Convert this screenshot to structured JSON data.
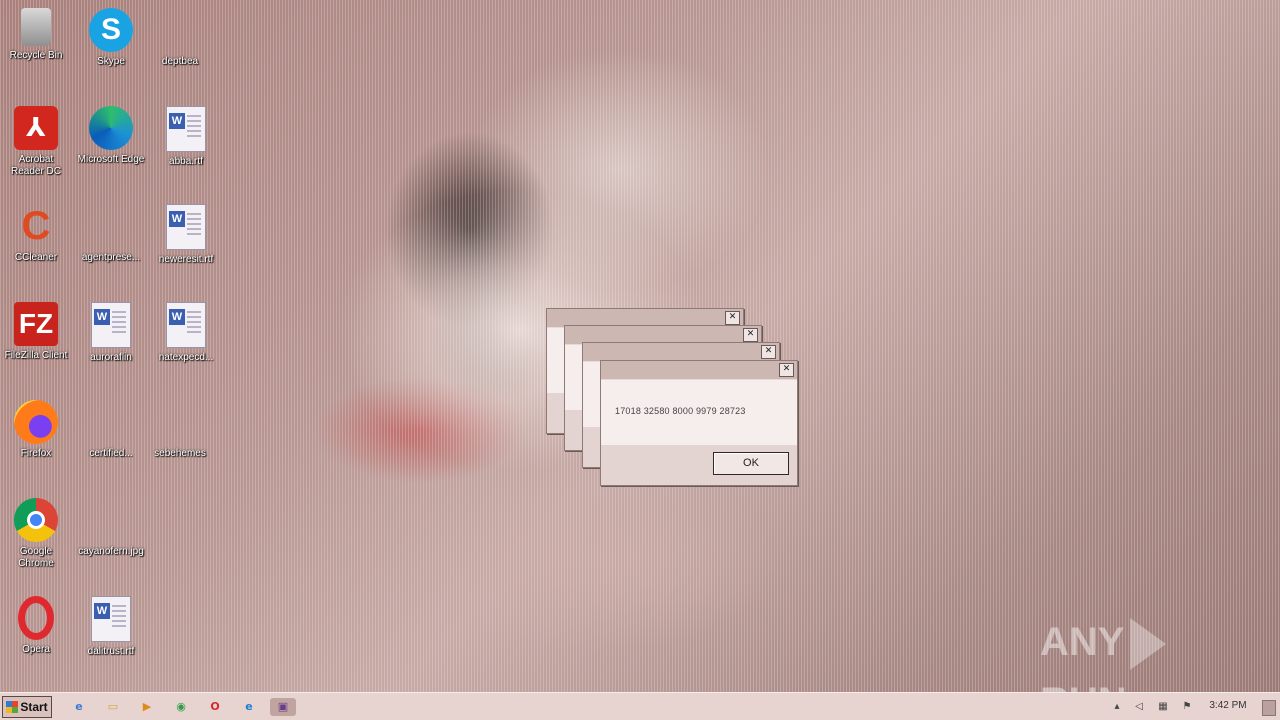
{
  "desktop": {
    "icons": [
      {
        "label": "Recycle Bin",
        "icon": "recycle-bin-icon"
      },
      {
        "label": "Skype",
        "icon": "skype-icon",
        "glyph": "S"
      },
      {
        "label": "deptbea",
        "icon": "document-icon"
      },
      {
        "label": "Acrobat Reader DC",
        "icon": "acrobat-reader-icon",
        "glyph": "⅄"
      },
      {
        "label": "Microsoft Edge",
        "icon": "edge-icon"
      },
      {
        "label": "abba.rtf",
        "icon": "word-document-icon"
      },
      {
        "label": "CCleaner",
        "icon": "ccleaner-icon",
        "glyph": "C"
      },
      {
        "label": "agentprese...",
        "icon": "document-icon"
      },
      {
        "label": "neweresit.rtf",
        "icon": "word-document-icon"
      },
      {
        "label": "FileZilla Client",
        "icon": "filezilla-icon",
        "glyph": "FZ"
      },
      {
        "label": "auroraflin",
        "icon": "word-document-icon"
      },
      {
        "label": "natexpecd...",
        "icon": "word-document-icon"
      },
      {
        "label": "Firefox",
        "icon": "firefox-icon"
      },
      {
        "label": "certified...",
        "icon": "document-icon"
      },
      {
        "label": "sebehemes",
        "icon": "document-icon"
      },
      {
        "label": "Google Chrome",
        "icon": "chrome-icon"
      },
      {
        "label": "cayanofern.jpg",
        "icon": "image-file-icon"
      },
      {
        "label": "Opera",
        "icon": "opera-icon"
      },
      {
        "label": "dalitrust.rtf",
        "icon": "word-document-icon"
      }
    ]
  },
  "dialogs": {
    "stack": [
      {
        "close": "✕",
        "message": "",
        "ok": "OK"
      },
      {
        "close": "✕",
        "message": "",
        "ok": "OK"
      },
      {
        "close": "✕",
        "message": "",
        "ok": "OK"
      },
      {
        "close": "✕",
        "message": "17018 32580 8000 9979 28723",
        "ok": "OK"
      }
    ]
  },
  "watermark": {
    "left": "ANY",
    "right": "RUN"
  },
  "taskbar": {
    "start_label": "Start",
    "quick_launch": [
      {
        "icon": "ie-icon",
        "glyph": "e",
        "color": "#3b7bd4"
      },
      {
        "icon": "explorer-folder-icon",
        "glyph": "▭",
        "color": "#d6a53c"
      },
      {
        "icon": "media-player-icon",
        "glyph": "▶",
        "color": "#e08a1c"
      },
      {
        "icon": "chrome-icon",
        "glyph": "◉",
        "color": "#2f9d4d"
      },
      {
        "icon": "opera-icon",
        "glyph": "O",
        "color": "#d22a2a"
      },
      {
        "icon": "edge-icon",
        "glyph": "e",
        "color": "#1d7fd0"
      },
      {
        "icon": "app-window-icon",
        "glyph": "▣",
        "color": "#6b3a8a"
      }
    ],
    "tray": [
      {
        "icon": "tray-arrow-icon",
        "glyph": "▴"
      },
      {
        "icon": "volume-icon",
        "glyph": "◁"
      },
      {
        "icon": "network-icon",
        "glyph": "▦"
      },
      {
        "icon": "flag-icon",
        "glyph": "⚑"
      }
    ],
    "clock": "3:42 PM"
  },
  "colors": {
    "taskbar_bg": "#e7d3cf",
    "dialog_bg": "#f5eeec",
    "accent": "#1a4fbf"
  }
}
